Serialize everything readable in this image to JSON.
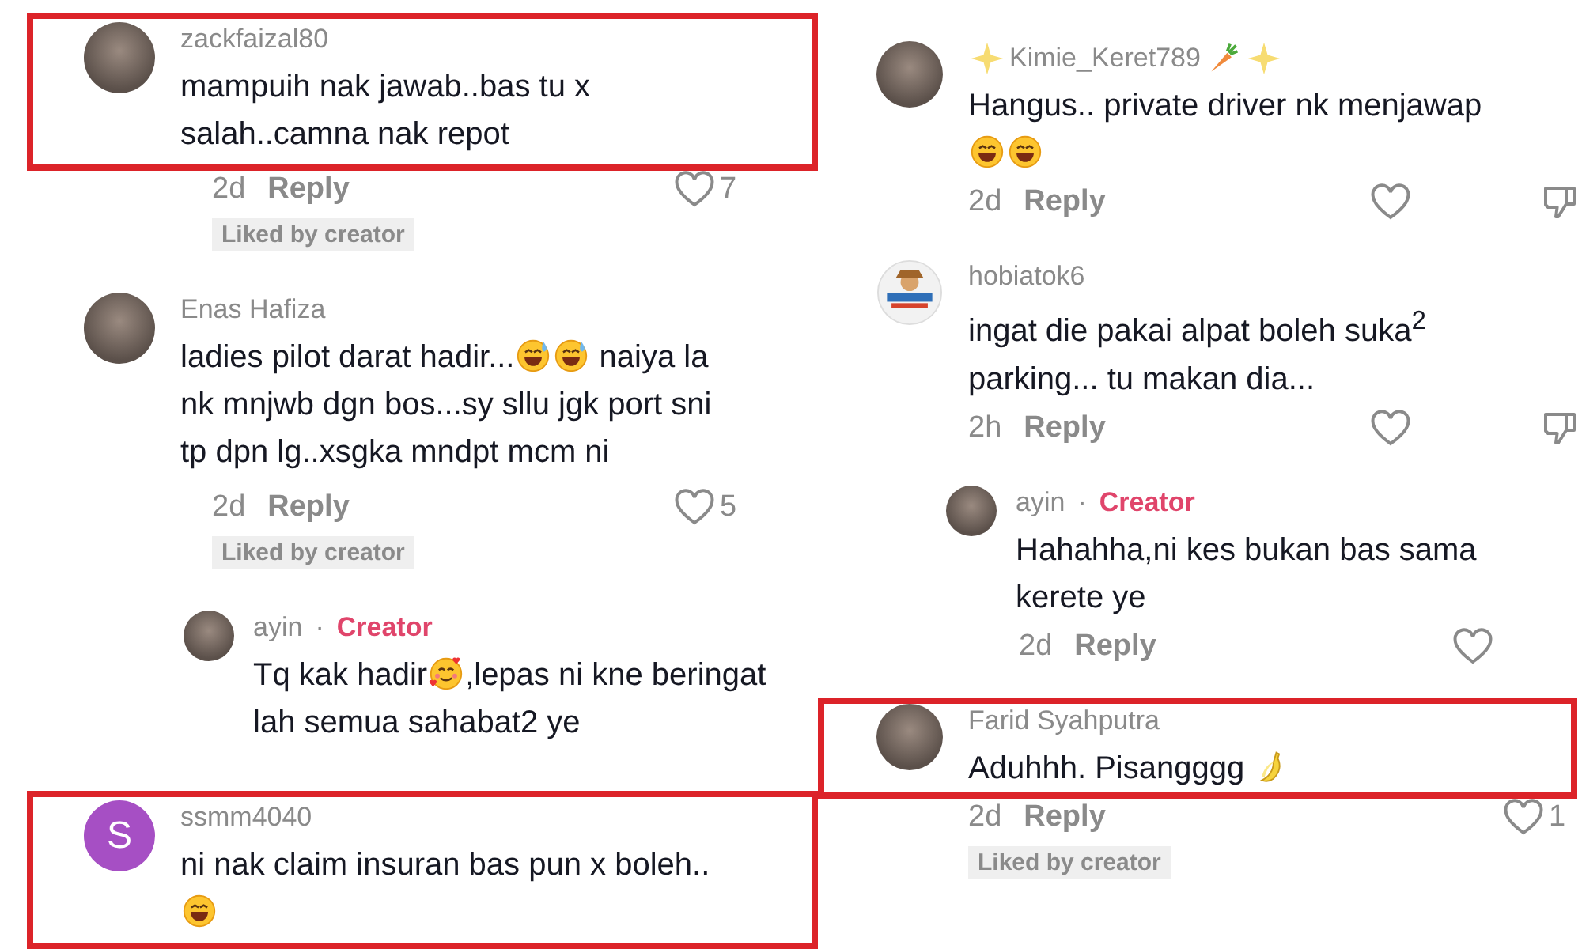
{
  "columns": [
    {
      "comments": [
        {
          "avatar": {
            "kind": "photo"
          },
          "name": "zackfaizal80",
          "highlighted": true,
          "body": [
            {
              "kind": "text",
              "text": "mampuih nak jawab..bas tu x salah..camna nak repot"
            }
          ],
          "time": "2d",
          "reply": "Reply",
          "likes": "7",
          "badge": "Liked by creator"
        },
        {
          "avatar": {
            "kind": "photo"
          },
          "name": "Enas Hafiza",
          "highlighted": false,
          "body": [
            {
              "kind": "text",
              "text": "ladies pilot darat hadir..."
            },
            {
              "kind": "sweat"
            },
            {
              "kind": "sweat"
            },
            {
              "kind": "text",
              "text": " naiya la nk mnjwb dgn bos...sy sllu jgk port sni tp dpn lg..xsgka mndpt mcm ni"
            }
          ],
          "time": "2d",
          "reply": "Reply",
          "likes": "5",
          "badge": "Liked by creator"
        },
        {
          "avatar": {
            "kind": "photo"
          },
          "name": "ayin",
          "separator": "·",
          "role": "Creator",
          "nested": true,
          "highlighted": false,
          "body": [
            {
              "kind": "text",
              "text": "Tq kak hadir"
            },
            {
              "kind": "hearts"
            },
            {
              "kind": "text",
              "text": ",lepas ni kne beringat lah semua sahabat2 ye"
            }
          ]
        },
        {
          "avatar": {
            "kind": "letter",
            "letter": "S",
            "color": "#a64fc4"
          },
          "name": "ssmm4040",
          "highlighted": true,
          "body": [
            {
              "kind": "text",
              "text": "ni nak claim insuran bas pun x boleh.. "
            },
            {
              "kind": "laugh"
            }
          ]
        }
      ]
    },
    {
      "comments": [
        {
          "avatar": {
            "kind": "photo"
          },
          "name_before": [
            {
              "kind": "sparkle"
            }
          ],
          "name": "Kimie_Keret789",
          "name_after": [
            {
              "kind": "carrot"
            },
            {
              "kind": "sparkle"
            }
          ],
          "highlighted": false,
          "body": [
            {
              "kind": "text",
              "text": "Hangus.. private driver nk menjawap "
            },
            {
              "kind": "laugh"
            },
            {
              "kind": "laugh"
            }
          ],
          "time": "2d",
          "reply": "Reply",
          "dislike": true
        },
        {
          "avatar": {
            "kind": "drawing"
          },
          "name": "hobiatok6",
          "highlighted": false,
          "body": [
            {
              "kind": "text",
              "text": "ingat die pakai alpat boleh suka$^{2}$ parking... tu makan dia..."
            }
          ],
          "time": "2h",
          "reply": "Reply",
          "dislike": true
        },
        {
          "avatar": {
            "kind": "photo"
          },
          "name": "ayin",
          "separator": "·",
          "role": "Creator",
          "nested": true,
          "highlighted": false,
          "body": [
            {
              "kind": "text",
              "text": "Hahahha,ni kes bukan bas sama kerete ye"
            }
          ],
          "time": "2d",
          "reply": "Reply",
          "dislike": false
        },
        {
          "avatar": {
            "kind": "photo"
          },
          "name": "Farid Syahputra",
          "highlighted": true,
          "body": [
            {
              "kind": "text",
              "text": "Aduhhh. Pisangggg "
            },
            {
              "kind": "banana"
            }
          ],
          "time": "2d",
          "reply": "Reply",
          "likes": "1",
          "badge": "Liked by creator"
        }
      ]
    }
  ]
}
